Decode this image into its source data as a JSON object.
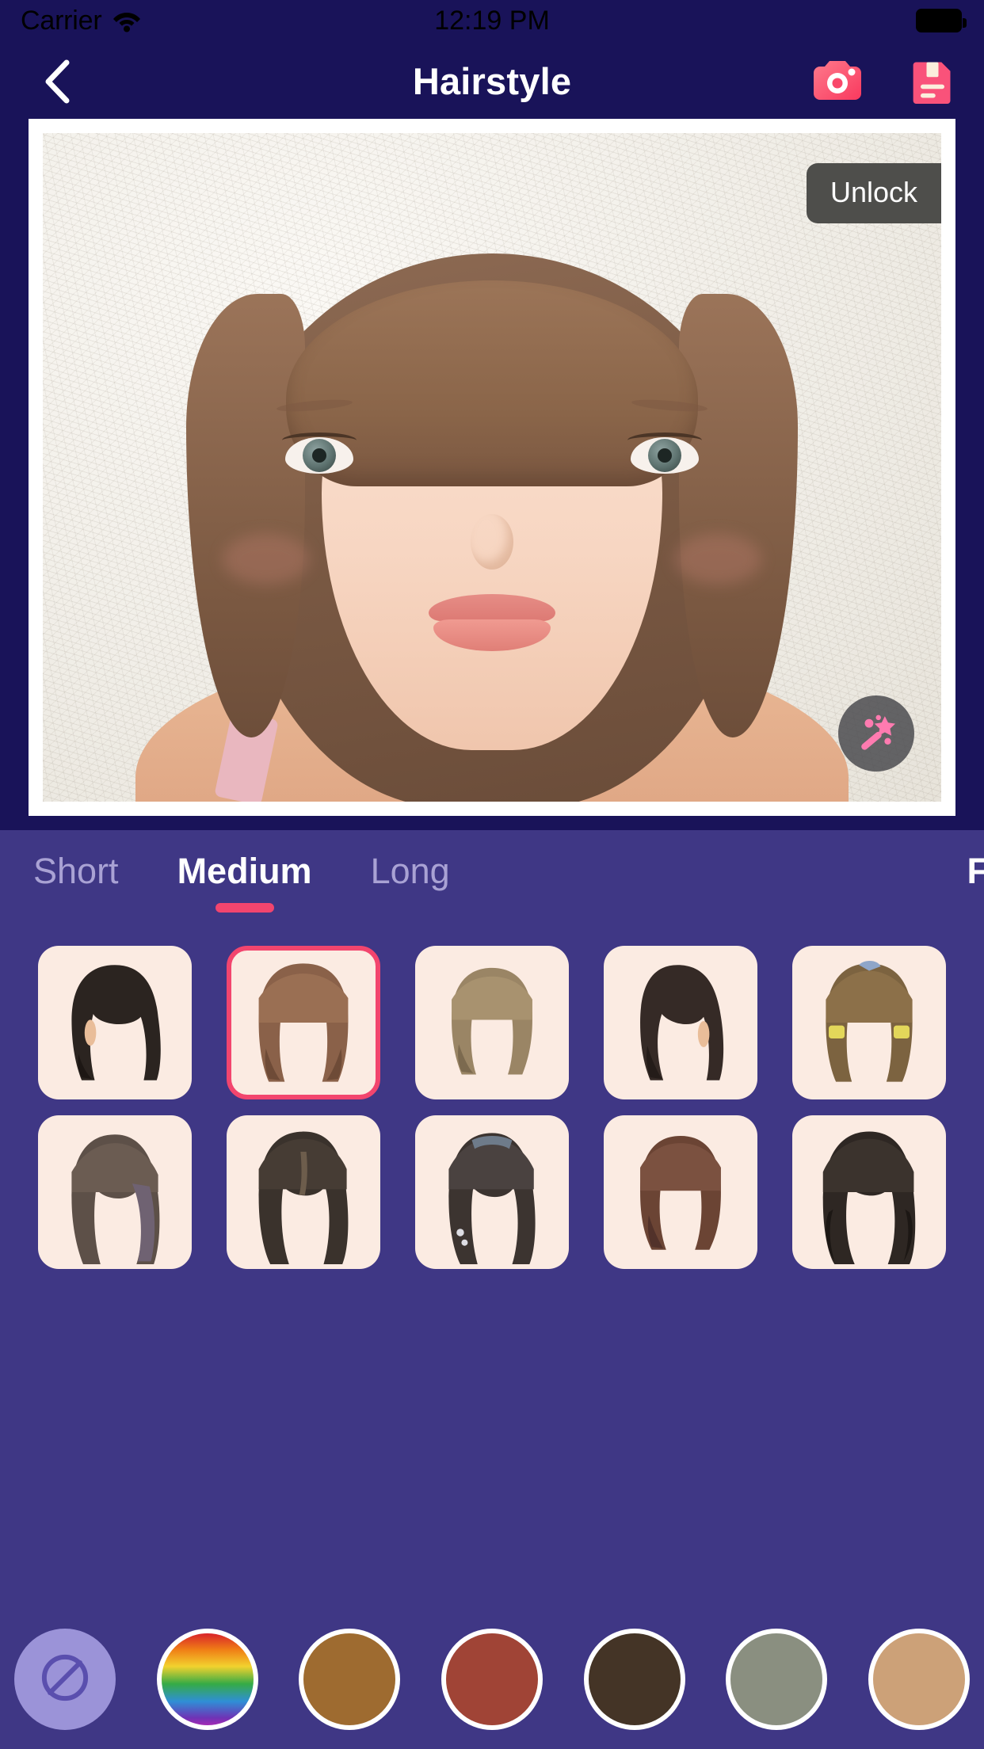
{
  "status_bar": {
    "carrier": "Carrier",
    "wifi_icon": "wifi-icon",
    "time": "12:19 PM",
    "battery_icon": "battery-full-icon"
  },
  "nav": {
    "back_icon": "chevron-left-icon",
    "title": "Hairstyle",
    "camera_icon": "camera-icon",
    "document_icon": "document-list-icon"
  },
  "photo": {
    "unlock_label": "Unlock",
    "magic_icon": "magic-wand-icon",
    "alt": "portrait preview with medium brown bob hairstyle and blunt fringe"
  },
  "tabs": {
    "items": [
      {
        "label": "Short",
        "active": false
      },
      {
        "label": "Medium",
        "active": true
      },
      {
        "label": "Long",
        "active": false
      }
    ],
    "edge_label": "F",
    "active_index": 1,
    "indicator_color": "#F2456E"
  },
  "styles": {
    "selected_index": 1,
    "items": [
      {
        "name": "straight-dark-bob",
        "hair": "#2b2420",
        "tip": "#1d1714",
        "shape": "bob-parted"
      },
      {
        "name": "brown-blunt-fringe-bob",
        "hair": "#8a6149",
        "tip": "#6e4b37",
        "shape": "fringe-bob"
      },
      {
        "name": "ash-blonde-fringe-bob",
        "hair": "#9a8565",
        "tip": "#7c6a4f",
        "shape": "fringe-bob"
      },
      {
        "name": "dark-sleek-lob",
        "hair": "#352a26",
        "tip": "#241c19",
        "shape": "bob-parted"
      },
      {
        "name": "brown-pigtail-clips",
        "hair": "#7c6340",
        "tip": "#5e4a2f",
        "shape": "fringe-bob"
      },
      {
        "name": "ash-layered-lob",
        "hair": "#5d5048",
        "tip": "#463c36",
        "shape": "long-wave"
      },
      {
        "name": "black-long-fringe",
        "hair": "#3a322c",
        "tip": "#241f1b",
        "shape": "long-wave"
      },
      {
        "name": "dark-long-straight",
        "hair": "#3c3430",
        "tip": "#262020",
        "shape": "long-wave"
      },
      {
        "name": "auburn-round-bob",
        "hair": "#6b4434",
        "tip": "#52322a",
        "shape": "fringe-bob"
      },
      {
        "name": "black-wavy-long",
        "hair": "#2e2723",
        "tip": "#1c1714",
        "shape": "long-wave"
      }
    ]
  },
  "colors": {
    "selected_index": 0,
    "items": [
      {
        "name": "no-color",
        "value": "none",
        "icon": "prohibit-icon"
      },
      {
        "name": "rainbow",
        "value": "rainbow"
      },
      {
        "name": "caramel-brown",
        "value": "#9E6B30"
      },
      {
        "name": "rust-red",
        "value": "#A04436"
      },
      {
        "name": "dark-espresso",
        "value": "#443426"
      },
      {
        "name": "sage-gray",
        "value": "#8A8F80"
      },
      {
        "name": "tan-beige",
        "value": "#CCA178"
      }
    ]
  },
  "theme": {
    "header_bg": "#191359",
    "panel_bg": "#3F3785",
    "accent": "#F2456E",
    "accent_icon": "#FC5B72",
    "thumb_bg": "#FBEBE2",
    "tab_inactive": "#A9A2D4"
  }
}
